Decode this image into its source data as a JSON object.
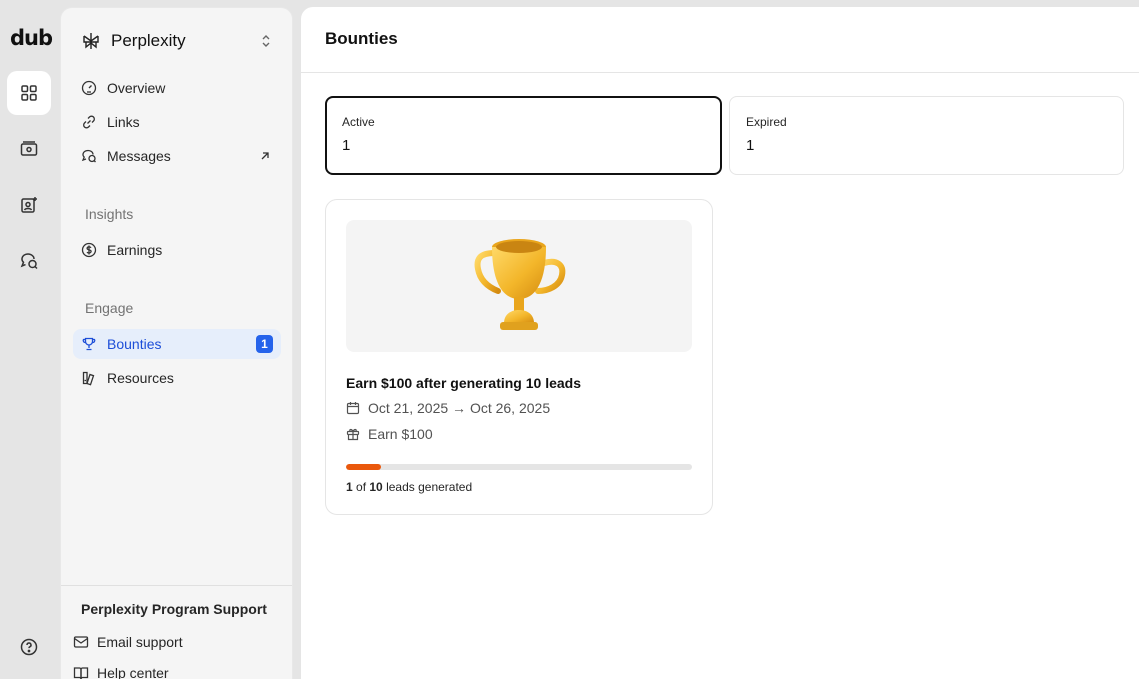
{
  "brand": {
    "logo": "dub"
  },
  "rail": {
    "items": [
      {
        "icon": "grid-icon",
        "active": true
      },
      {
        "icon": "wallet-icon",
        "active": false
      },
      {
        "icon": "user-sparkle-icon",
        "active": false
      },
      {
        "icon": "messages-icon",
        "active": false
      }
    ],
    "help_icon": "help-circle-icon"
  },
  "sidebar": {
    "program_name": "Perplexity",
    "nav": [
      {
        "label": "Overview",
        "icon": "gauge-icon"
      },
      {
        "label": "Links",
        "icon": "link-icon"
      },
      {
        "label": "Messages",
        "icon": "messages-icon",
        "external": true
      }
    ],
    "insights_label": "Insights",
    "insights_items": [
      {
        "label": "Earnings",
        "icon": "dollar-circle-icon"
      }
    ],
    "engage_label": "Engage",
    "engage_items": [
      {
        "label": "Bounties",
        "icon": "trophy-icon",
        "active": true,
        "badge": "1"
      },
      {
        "label": "Resources",
        "icon": "resources-icon"
      }
    ],
    "support": {
      "title": "Perplexity Program Support",
      "email": "Email support",
      "help": "Help center"
    }
  },
  "main": {
    "title": "Bounties",
    "stats": [
      {
        "label": "Active",
        "value": "1",
        "selected": true
      },
      {
        "label": "Expired",
        "value": "1",
        "selected": false
      }
    ],
    "bounty": {
      "title": "Earn $100 after generating 10 leads",
      "dates": "Oct 21, 2025 → Oct 26, 2025",
      "reward": "Earn $100",
      "progress": {
        "current": "1",
        "total": "10",
        "fraction": 0.1,
        "middle": " of ",
        "suffix": " leads generated"
      },
      "accent": "#ea580c"
    }
  }
}
